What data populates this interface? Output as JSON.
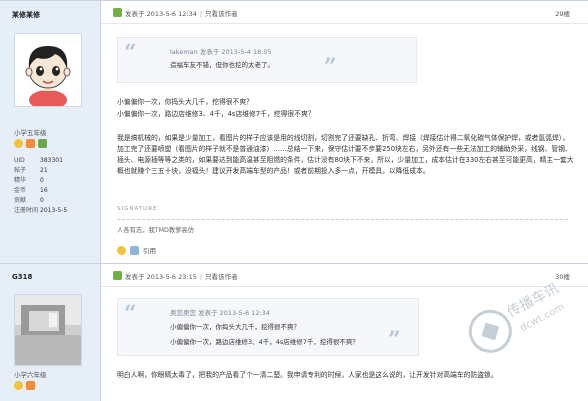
{
  "post1": {
    "username": "某修某修",
    "rank": "小学五年级",
    "stats": [
      {
        "label": "UID",
        "value": "383301"
      },
      {
        "label": "帖子",
        "value": "21"
      },
      {
        "label": "精华",
        "value": "0"
      },
      {
        "label": "金币",
        "value": "16"
      },
      {
        "label": "贡献",
        "value": "0"
      },
      {
        "label": "注册时间",
        "value": "2013-5-5"
      }
    ],
    "posted": "发表于 2013-5-6 12:34",
    "view_author": "只看该作者",
    "floor": "29楼",
    "quote": {
      "author": "lakeman 发表于 2013-5-4 18:05",
      "text": "造福车友不错，但你也挖的太老了。"
    },
    "body": [
      "小偏偏你一次，你捣头大几千，挖得很不爽？",
      "小偏偏你一次，路边店维修3、4千，4s店维修7千，挖得很不爽？",
      "",
      "我是搞机械的，如果是少量加工，看图片的样子应该是用的线切割，切割完了还要缺孔、折弯、焊接（焊接估计得二氧化碳气体保护焊，或者氩弧焊），加工完了还要喷塑（看图片的样子就不是普通油漆）……总结一下来，保守估计要不步要250块左右，另外还有一些无法加工的辅助外采，线钢、管钢、插头、电源插等等之类的，如果要达到能高温甚至阻燃的条件，估计没有80块下不来，所以，少量加工，成本估计在330左右甚至可能更高，精主一套大概也就赚个三五十块，没福头！建议开发高端车型的产品！或者前期投入多一点，开模具，以降低成本。"
    ],
    "signature_head": "SIGNATURE",
    "signature": "人各有志，我TMD教爹高仿",
    "footer_label": "引用"
  },
  "post2": {
    "username": "G318",
    "rank": "小学六年级",
    "posted": "发表于 2013-5-6 23:15",
    "view_author": "只看该作者",
    "floor": "30楼",
    "quote": {
      "author": "奥您奥您 发表于 2013-5-6 12:34",
      "lines": [
        "小偏偏你一次，你捣头大几千，挖得很不爽？",
        "小偏偏你一次，路边店维修3、4千，4s店维修7千，挖得很不爽？"
      ]
    },
    "body": [
      "明白人啊，你眼睛太毒了，把我的产品看了个一清二楚。我申请专利的时候，人家也是这么说的，让开发针对高端车的防盗锁。"
    ]
  },
  "watermark": "传播车讯 dcwt.com",
  "colors": {
    "sidebar": "#e6eef7",
    "border": "#c8d4e3",
    "online": "#6db33f",
    "quote_bg": "#f5f7fa",
    "quote_mark": "#b7c6d6"
  }
}
